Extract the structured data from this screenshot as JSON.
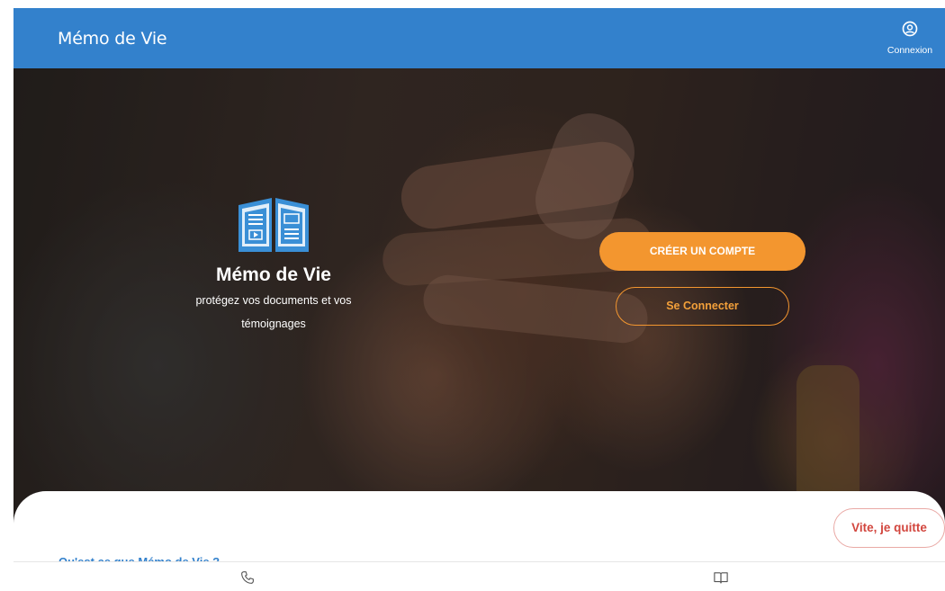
{
  "header": {
    "app_title": "Mémo de Vie",
    "login_label": "Connexion",
    "login_icon": "account-circle-icon"
  },
  "hero": {
    "brand_name": "Mémo de Vie",
    "tagline_line1": "protégez vos documents et vos",
    "tagline_line2": "témoignages",
    "logo_icon": "open-book-icon",
    "create_account_label": "CRÉER UN COMPTE",
    "sign_in_label": "Se Connecter"
  },
  "content": {
    "section_title": "Qu'est ce que Mémo de Vie ?",
    "quick_exit_label": "Vite, je quitte"
  },
  "bottom_nav": {
    "items": [
      {
        "icon": "phone-icon"
      },
      {
        "icon": "book-icon"
      }
    ]
  },
  "colors": {
    "header_bg": "#3381cc",
    "accent_orange": "#f3962f",
    "quit_red": "#d2463e",
    "logo_blue": "#3a8fd6"
  }
}
